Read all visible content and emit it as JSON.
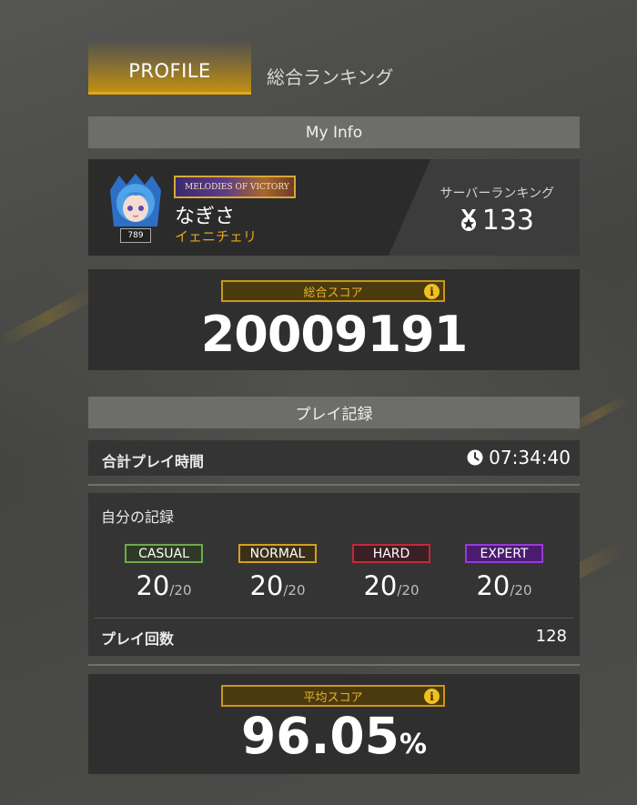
{
  "tabs": {
    "profile": "PROFILE",
    "ranking": "総合ランキング"
  },
  "my_info": {
    "header": "My Info",
    "title_badge": "MELODIES OF VICTORY",
    "avatar_level": "789",
    "player_name": "なぎさ",
    "player_subtitle": "イェニチェリ",
    "server_rank_label": "サーバーランキング",
    "server_rank_value": "133"
  },
  "total_score": {
    "label": "総合スコア",
    "value": "20009191"
  },
  "play_record": {
    "header": "プレイ記録",
    "total_play_time_label": "合計プレイ時間",
    "total_play_time_value": "07:34:40"
  },
  "records": {
    "title": "自分の記録",
    "difficulties": [
      {
        "label": "CASUAL",
        "value": "20",
        "max": "/20",
        "color": "#6fa84a",
        "bg": "#2f3a26"
      },
      {
        "label": "NORMAL",
        "value": "20",
        "max": "/20",
        "color": "#d4a020",
        "bg": "#3a301a"
      },
      {
        "label": "HARD",
        "value": "20",
        "max": "/20",
        "color": "#c02a3a",
        "bg": "#3a1f24"
      },
      {
        "label": "EXPERT",
        "value": "20",
        "max": "/20",
        "color": "#9a3ad8",
        "bg": "#4a1c70"
      }
    ],
    "play_count_label": "プレイ回数",
    "play_count_value": "128"
  },
  "average_score": {
    "label": "平均スコア",
    "value": "96.05",
    "unit": "%"
  },
  "colors": {
    "accent": "#e0a818",
    "panel": "#2f2f2f",
    "header": "#6d6d6b"
  }
}
